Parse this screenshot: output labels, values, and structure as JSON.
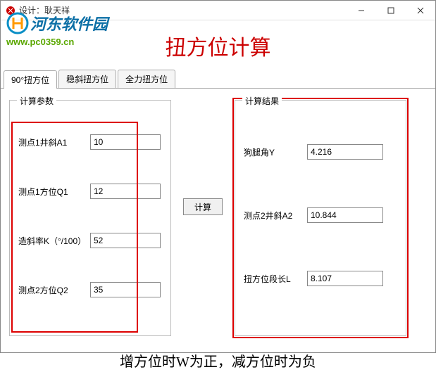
{
  "window": {
    "title": "设计：耿天祥"
  },
  "watermark": {
    "site_name": "河东软件园",
    "url": "www.pc0359.cn"
  },
  "main_title": "扭方位计算",
  "tabs": [
    {
      "label": "90°扭方位",
      "active": true
    },
    {
      "label": "稳斜扭方位",
      "active": false
    },
    {
      "label": "全力扭方位",
      "active": false
    }
  ],
  "params": {
    "legend": "计算参数",
    "rows": [
      {
        "label": "测点1井斜A1",
        "value": "10"
      },
      {
        "label": "测点1方位Q1",
        "value": "12"
      },
      {
        "label": "造斜率K（°/100）",
        "value": "52"
      },
      {
        "label": "测点2方位Q2",
        "value": "35"
      }
    ]
  },
  "calc_button": "计算",
  "results": {
    "legend": "计算结果",
    "rows": [
      {
        "label": "狗腿角Y",
        "value": "4.216"
      },
      {
        "label": "测点2井斜A2",
        "value": "10.844"
      },
      {
        "label": "扭方位段长L",
        "value": "8.107"
      }
    ]
  },
  "footer": "增方位时W为正，减方位时为负"
}
